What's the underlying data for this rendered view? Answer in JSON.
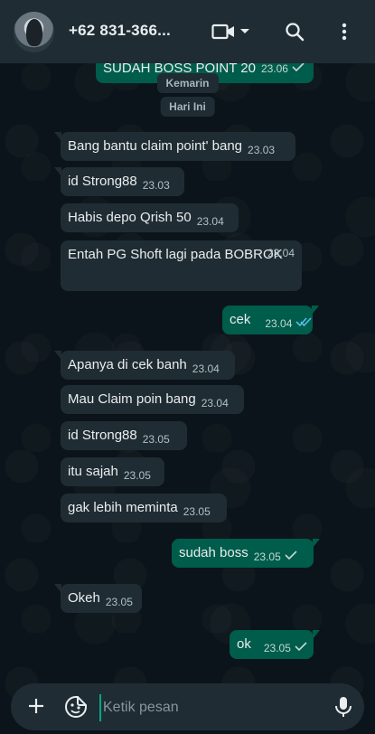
{
  "header": {
    "contact_name": "+62 831-366...",
    "icons": [
      "video-icon",
      "dropdown-caret-icon",
      "search-icon",
      "more-vertical-icon"
    ]
  },
  "date_chips": {
    "yesterday": "Kemarin",
    "today": "Hari Ini"
  },
  "top_partial_message": {
    "text": "SUDAH BOSS POINT 20",
    "time": "23.06"
  },
  "messages": [
    {
      "dir": "in",
      "text": "Bang bantu claim point' bang",
      "time": "23.03"
    },
    {
      "dir": "in",
      "text": "id Strong88",
      "time": "23.03"
    },
    {
      "dir": "in",
      "text": "Habis depo Qrish 50",
      "time": "23.04"
    },
    {
      "dir": "in",
      "text": "Entah PG Shoft lagi pada BOBROK",
      "time": "23.04"
    },
    {
      "dir": "out",
      "text": "cek",
      "time": "23.04",
      "status": "read"
    },
    {
      "dir": "in",
      "text": "Apanya di cek banh",
      "time": "23.04"
    },
    {
      "dir": "in",
      "text": "Mau Claim poin bang",
      "time": "23.04"
    },
    {
      "dir": "in",
      "text": "id Strong88",
      "time": "23.05"
    },
    {
      "dir": "in",
      "text": "itu sajah",
      "time": "23.05"
    },
    {
      "dir": "in",
      "text": "gak lebih meminta",
      "time": "23.05"
    },
    {
      "dir": "out",
      "text": "sudah boss",
      "time": "23.05",
      "status": "pending"
    },
    {
      "dir": "in",
      "text": "Okeh",
      "time": "23.05"
    },
    {
      "dir": "out",
      "text": "ok",
      "time": "23.05",
      "status": "pending"
    }
  ],
  "input": {
    "placeholder": "Ketik pesan"
  },
  "colors": {
    "background": "#0b141a",
    "incoming_bubble": "#1f2c33",
    "outgoing_bubble": "#005c4b",
    "read_tick": "#53bdeb",
    "accent": "#00a884"
  }
}
